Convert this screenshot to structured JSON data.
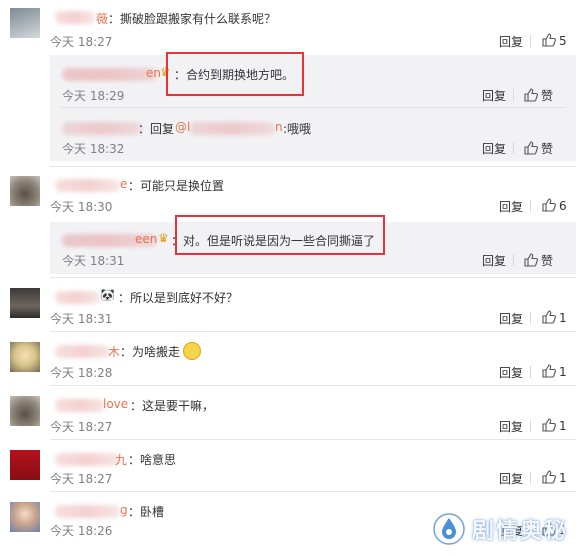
{
  "colors": {
    "highlight": "#e8333a",
    "link": "#eb7350",
    "timestamp": "#808080",
    "reply_bg": "#f2f2f5"
  },
  "comments": [
    {
      "name_tail": "薇",
      "text": "：撕破脸跟搬家有什么联系呢？",
      "time": "今天 18:27",
      "reply_label": "回复",
      "likes": "5",
      "replies": [
        {
          "name": "FirstL",
          "name_tail": "en",
          "text": "：合约到期换地方吧。",
          "time": "今天 18:29",
          "reply_label": "回复",
          "like_label": "赞"
        },
        {
          "name": "",
          "text_prefix": "：回复",
          "mention": "@l",
          "mention_tail": "n",
          "text": ":哦哦",
          "time": "今天 18:32",
          "reply_label": "回复",
          "like_label": "赞"
        }
      ]
    },
    {
      "name_tail": "e",
      "text": "：可能只是换位置",
      "time": "今天 18:30",
      "reply_label": "回复",
      "likes": "6",
      "replies": [
        {
          "name": "FirstG",
          "name_tail": "een",
          "text": "：对。但是听说是因为一些合同撕逼了",
          "time": "今天 18:31",
          "reply_label": "回复",
          "like_label": "赞"
        }
      ]
    },
    {
      "name_tail": "",
      "text": "：所以是到底好不好？",
      "time": "今天 18:31",
      "reply_label": "回复",
      "likes": "1"
    },
    {
      "name_tail": "木",
      "text": "：为啥搬走",
      "time": "今天 18:28",
      "reply_label": "回复",
      "likes": "1"
    },
    {
      "name_tail": "love",
      "text": "：这是要干嘛，",
      "time": "今天 18:27",
      "reply_label": "回复",
      "likes": "1"
    },
    {
      "name_tail": "九",
      "text": "：啥意思",
      "time": "今天 18:27",
      "reply_label": "回复",
      "likes": "1"
    },
    {
      "name_tail": "g",
      "text": "：卧槽",
      "time": "今天 18:26",
      "reply_label": "回复",
      "likes": "1"
    }
  ],
  "watermark": {
    "text": "剧情奥秘",
    "icon": "drop-logo-icon"
  }
}
